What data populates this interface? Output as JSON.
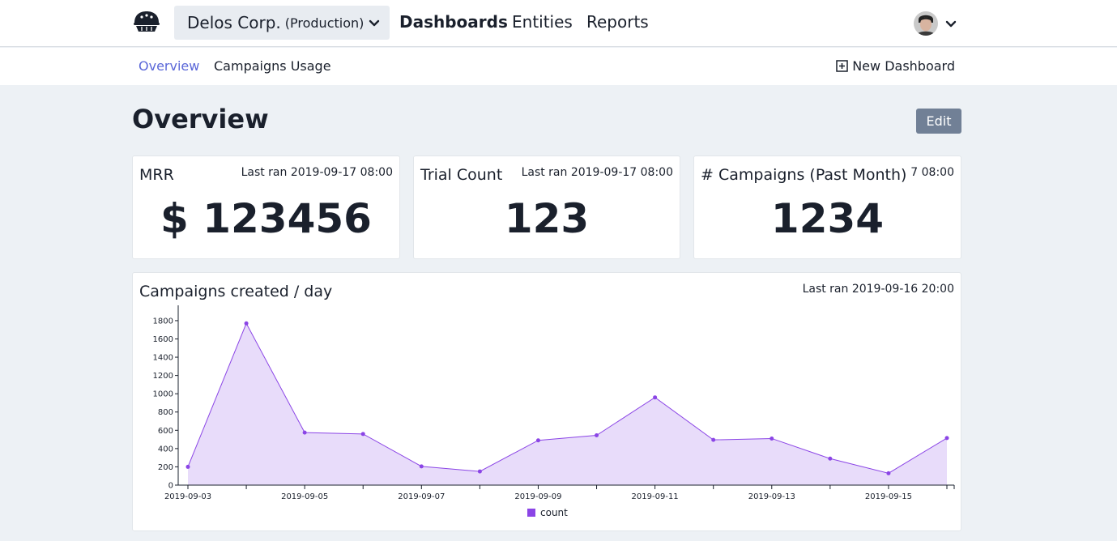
{
  "header": {
    "org_name": "Delos Corp.",
    "org_env": "(Production)",
    "nav": [
      {
        "label": "Dashboards",
        "active": true
      },
      {
        "label": "Entities",
        "active": false
      },
      {
        "label": "Reports",
        "active": false
      }
    ],
    "icons": {
      "logo": "pie-logo-icon",
      "org_dropdown": "chevron-down-icon",
      "user_dropdown": "chevron-down-icon"
    }
  },
  "subnav": {
    "tabs": [
      {
        "label": "Overview",
        "active": true
      },
      {
        "label": "Campaigns Usage",
        "active": false
      }
    ],
    "new_dashboard_label": "New Dashboard",
    "new_dashboard_icon": "plus-square-icon"
  },
  "page": {
    "title": "Overview",
    "edit_label": "Edit"
  },
  "cards": [
    {
      "title": "MRR",
      "meta": "Last ran 2019-09-17 08:00",
      "value": "$ 123456"
    },
    {
      "title": "Trial Count",
      "meta": "Last ran 2019-09-17 08:00",
      "value": "123"
    },
    {
      "title": "# Campaigns (Past Month)",
      "meta": "7 08:00",
      "value": "1234"
    }
  ],
  "chart_card": {
    "title": "Campaigns created / day",
    "meta": "Last ran 2019-09-16 20:00"
  },
  "colors": {
    "accent": "#5a67d8",
    "series_line": "#8b45e6",
    "series_fill": "#e8dcfa",
    "edit_button": "#718096"
  },
  "chart_data": {
    "type": "area",
    "x": [
      "2019-09-03",
      "2019-09-04",
      "2019-09-05",
      "2019-09-06",
      "2019-09-07",
      "2019-09-08",
      "2019-09-09",
      "2019-09-10",
      "2019-09-11",
      "2019-09-12",
      "2019-09-13",
      "2019-09-14",
      "2019-09-15",
      "2019-09-16"
    ],
    "x_tick_labels": [
      "2019-09-03",
      "2019-09-05",
      "2019-09-07",
      "2019-09-09",
      "2019-09-11",
      "2019-09-13",
      "2019-09-15"
    ],
    "series": [
      {
        "name": "count",
        "values": [
          200,
          1770,
          575,
          560,
          205,
          150,
          490,
          545,
          960,
          495,
          510,
          290,
          130,
          515
        ]
      }
    ],
    "y_ticks": [
      0,
      200,
      400,
      600,
      800,
      1000,
      1200,
      1400,
      1600,
      1800
    ],
    "ylim": [
      0,
      1950
    ],
    "grid": false,
    "legend": "bottom-center"
  }
}
